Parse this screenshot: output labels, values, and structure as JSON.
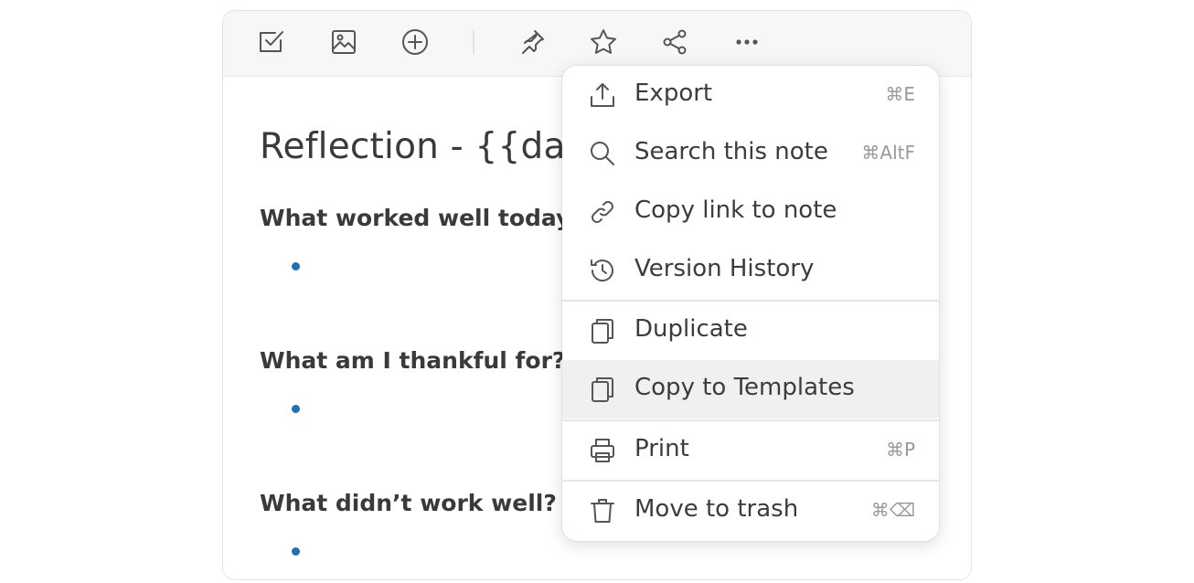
{
  "toolbar": {
    "icons": [
      "checkbox-icon",
      "image-icon",
      "add-circle-icon",
      "pin-icon",
      "star-icon",
      "share-icon",
      "more-icon"
    ]
  },
  "note": {
    "title": "Reflection - {{date",
    "sections": [
      {
        "question": "What worked well today?"
      },
      {
        "question": "What am I thankful for?"
      },
      {
        "question": "What didn’t work well?"
      }
    ]
  },
  "menu": {
    "items": [
      {
        "label": "Export",
        "shortcut": "⌘E",
        "icon": "export-icon"
      },
      {
        "label": "Search this note",
        "shortcut": "⌘AltF",
        "icon": "search-icon"
      },
      {
        "label": "Copy link to note",
        "shortcut": "",
        "icon": "link-icon"
      },
      {
        "label": "Version History",
        "shortcut": "",
        "icon": "history-icon"
      },
      {
        "label": "Duplicate",
        "shortcut": "",
        "icon": "duplicate-icon"
      },
      {
        "label": "Copy to Templates",
        "shortcut": "",
        "icon": "copy-icon"
      },
      {
        "label": "Print",
        "shortcut": "⌘P",
        "icon": "printer-icon"
      },
      {
        "label": "Move to trash",
        "shortcut": "⌘⌫",
        "icon": "trash-icon"
      }
    ]
  },
  "colors": {
    "bullet": "#1a73b8",
    "highlight": "#f0f0f0",
    "text": "#3a3a3a"
  }
}
